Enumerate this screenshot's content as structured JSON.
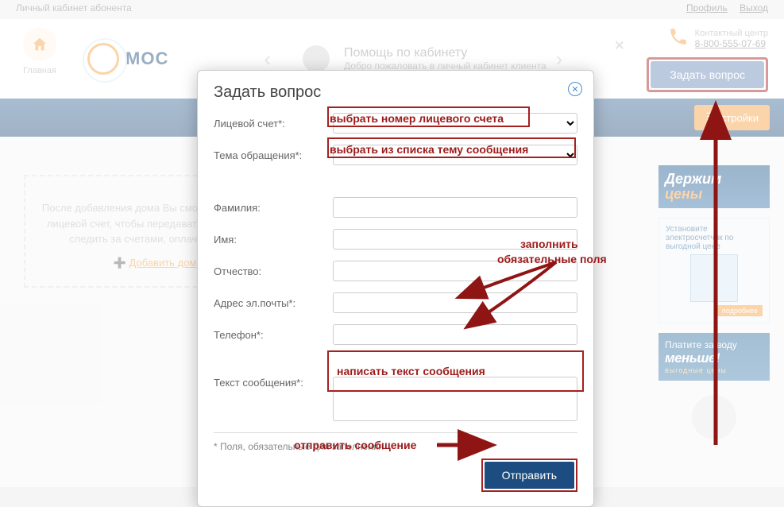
{
  "topbar": {
    "title": "Личный кабинет абонента",
    "profile": "Профиль",
    "logout": "Выход"
  },
  "header": {
    "home": "Главная",
    "logo": "МОС",
    "help_title": "Помощь по кабинету",
    "help_sub": "Добро пожаловать в личный кабинет клиента",
    "contact_label": "Контактный центр",
    "contact_phone": "8-800-555-07-69",
    "ask_button": "Задать вопрос",
    "settings": "стройки"
  },
  "bg": {
    "para": "После добавления дома Вы сможете добавить лицевой счет, чтобы передавать показания и следить за счетами, оплачивать их.",
    "add_home": "Добавить дом"
  },
  "ads": {
    "hold1": "Держим",
    "hold2": "цены",
    "sub": "Установите электросчетчик по выгодной цене",
    "more": "подробнее",
    "water1": "Платите за воду",
    "water2": "меньше!",
    "water3": "выгодные цены"
  },
  "modal": {
    "title": "Задать вопрос",
    "account": "Лицевой счет*:",
    "topic": "Тема обращения*:",
    "lastname": "Фамилия:",
    "firstname": "Имя:",
    "patronymic": "Отчество:",
    "email": "Адрес эл.почты*:",
    "phone": "Телефон*:",
    "message": "Текст сообщения*:",
    "footnote": "* Поля, обязательные для заполнения",
    "submit": "Отправить"
  },
  "annotations": {
    "select_account": "выбрать номер лицевого счета",
    "select_topic": "выбрать из списка тему сообщения",
    "fill_required1": "заполнить",
    "fill_required2": "обязательные поля",
    "write_message": "написать текст сообщения",
    "send_message": "отправить сообщение"
  }
}
